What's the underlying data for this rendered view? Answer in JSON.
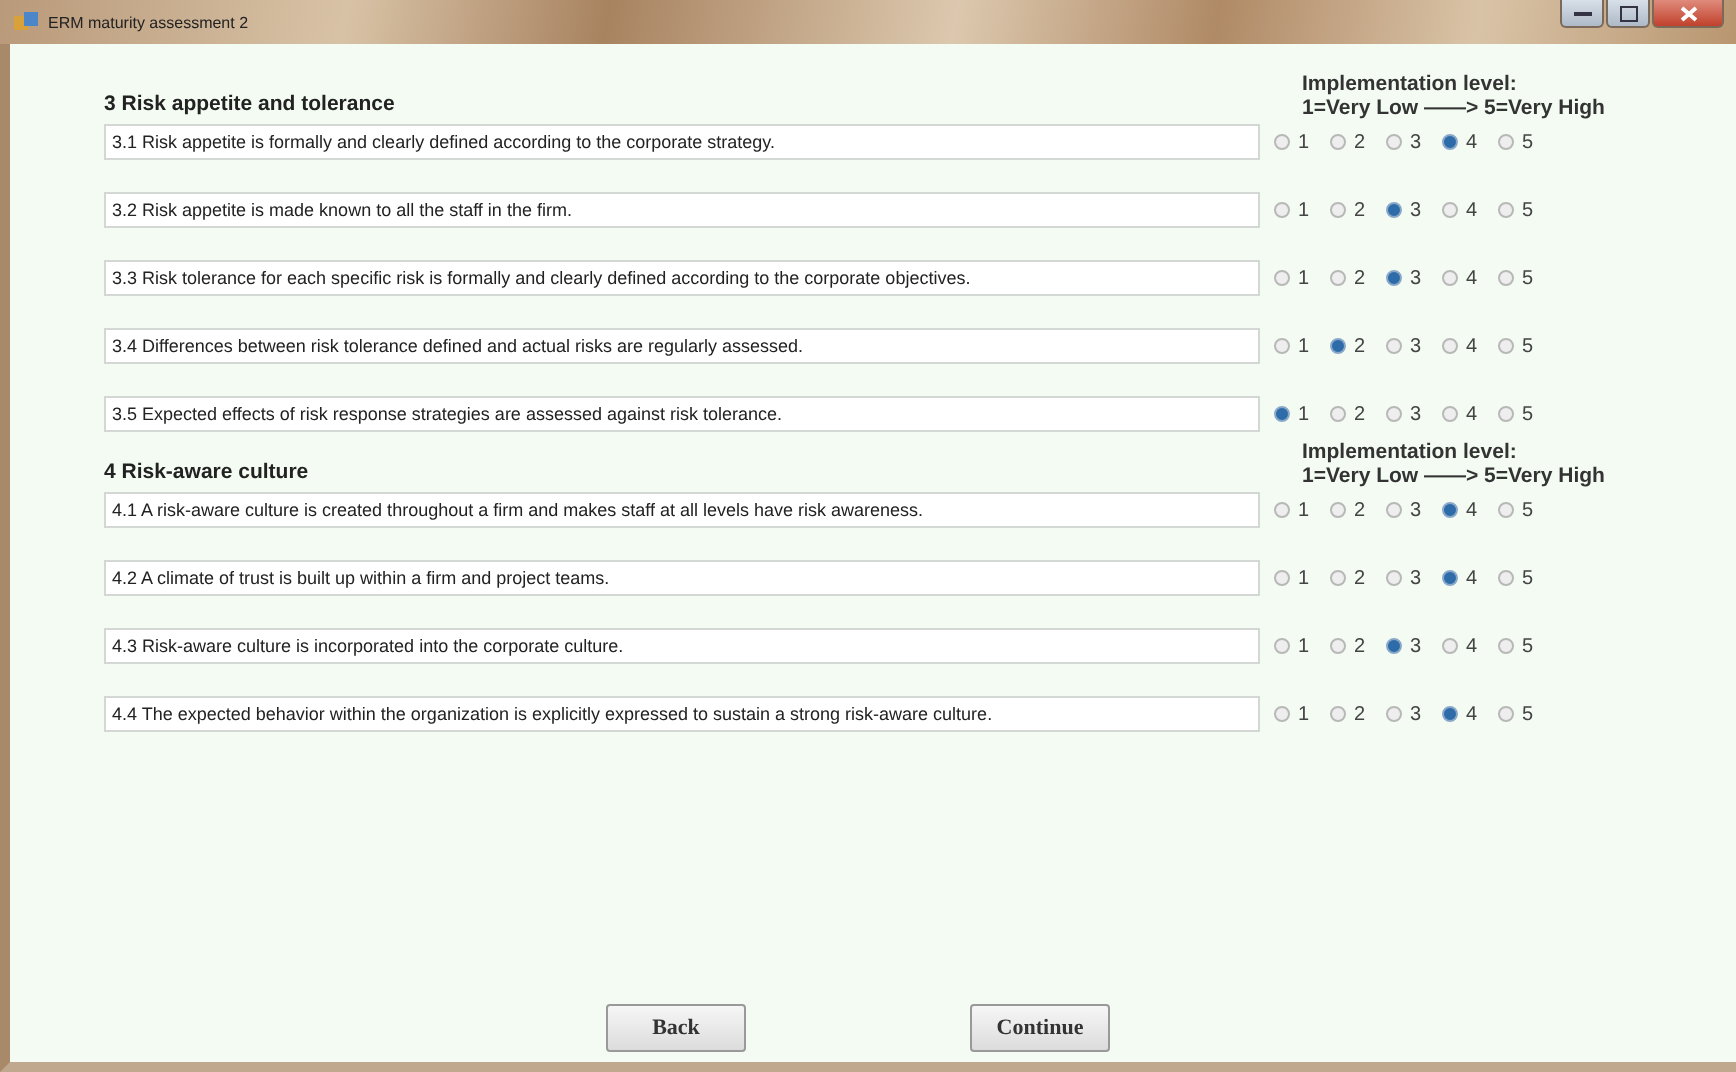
{
  "window": {
    "title": "ERM maturity assessment 2"
  },
  "sections": [
    {
      "title": "3 Risk appetite and tolerance",
      "scale_title": "Implementation level:",
      "scale_range": "1=Very Low ——> 5=Very High",
      "items": [
        {
          "text": "3.1 Risk appetite is formally and clearly defined according to the corporate strategy.",
          "options": [
            {
              "label": "1",
              "selected": false
            },
            {
              "label": "2",
              "selected": false
            },
            {
              "label": "3",
              "selected": false
            },
            {
              "label": "4",
              "selected": true
            },
            {
              "label": "5",
              "selected": false
            }
          ]
        },
        {
          "text": "3.2 Risk appetite is made known to all the staff in the firm.",
          "options": [
            {
              "label": "1",
              "selected": false
            },
            {
              "label": "2",
              "selected": false
            },
            {
              "label": "3",
              "selected": true
            },
            {
              "label": "4",
              "selected": false
            },
            {
              "label": "5",
              "selected": false
            }
          ]
        },
        {
          "text": "3.3 Risk tolerance for each specific risk is formally and clearly defined according to the corporate objectives.",
          "options": [
            {
              "label": "1",
              "selected": false
            },
            {
              "label": "2",
              "selected": false
            },
            {
              "label": "3",
              "selected": true
            },
            {
              "label": "4",
              "selected": false
            },
            {
              "label": "5",
              "selected": false
            }
          ]
        },
        {
          "text": "3.4 Differences between risk tolerance defined and actual risks are regularly assessed.",
          "options": [
            {
              "label": "1",
              "selected": false
            },
            {
              "label": "2",
              "selected": true
            },
            {
              "label": "3",
              "selected": false
            },
            {
              "label": "4",
              "selected": false
            },
            {
              "label": "5",
              "selected": false
            }
          ]
        },
        {
          "text": "3.5 Expected effects of risk response strategies are assessed against risk tolerance.",
          "options": [
            {
              "label": "1",
              "selected": true
            },
            {
              "label": "2",
              "selected": false
            },
            {
              "label": "3",
              "selected": false
            },
            {
              "label": "4",
              "selected": false
            },
            {
              "label": "5",
              "selected": false
            }
          ]
        }
      ]
    },
    {
      "title": "4 Risk-aware culture",
      "scale_title": "Implementation level:",
      "scale_range": "1=Very Low ——> 5=Very High",
      "items": [
        {
          "text": "4.1 A risk-aware culture is created throughout a firm and makes staff at all levels have risk awareness.",
          "options": [
            {
              "label": "1",
              "selected": false
            },
            {
              "label": "2",
              "selected": false
            },
            {
              "label": "3",
              "selected": false
            },
            {
              "label": "4",
              "selected": true
            },
            {
              "label": "5",
              "selected": false
            }
          ]
        },
        {
          "text": "4.2 A climate of trust is built up within a firm and project teams.",
          "options": [
            {
              "label": "1",
              "selected": false
            },
            {
              "label": "2",
              "selected": false
            },
            {
              "label": "3",
              "selected": false
            },
            {
              "label": "4",
              "selected": true
            },
            {
              "label": "5",
              "selected": false
            }
          ]
        },
        {
          "text": "4.3 Risk-aware culture is incorporated into the corporate culture.",
          "options": [
            {
              "label": "1",
              "selected": false
            },
            {
              "label": "2",
              "selected": false
            },
            {
              "label": "3",
              "selected": true
            },
            {
              "label": "4",
              "selected": false
            },
            {
              "label": "5",
              "selected": false
            }
          ]
        },
        {
          "text": "4.4 The expected behavior within the organization is explicitly expressed to sustain a strong risk-aware culture.",
          "options": [
            {
              "label": "1",
              "selected": false
            },
            {
              "label": "2",
              "selected": false
            },
            {
              "label": "3",
              "selected": false
            },
            {
              "label": "4",
              "selected": true
            },
            {
              "label": "5",
              "selected": false
            }
          ]
        }
      ]
    }
  ],
  "buttons": [
    "Back",
    "Continue"
  ]
}
